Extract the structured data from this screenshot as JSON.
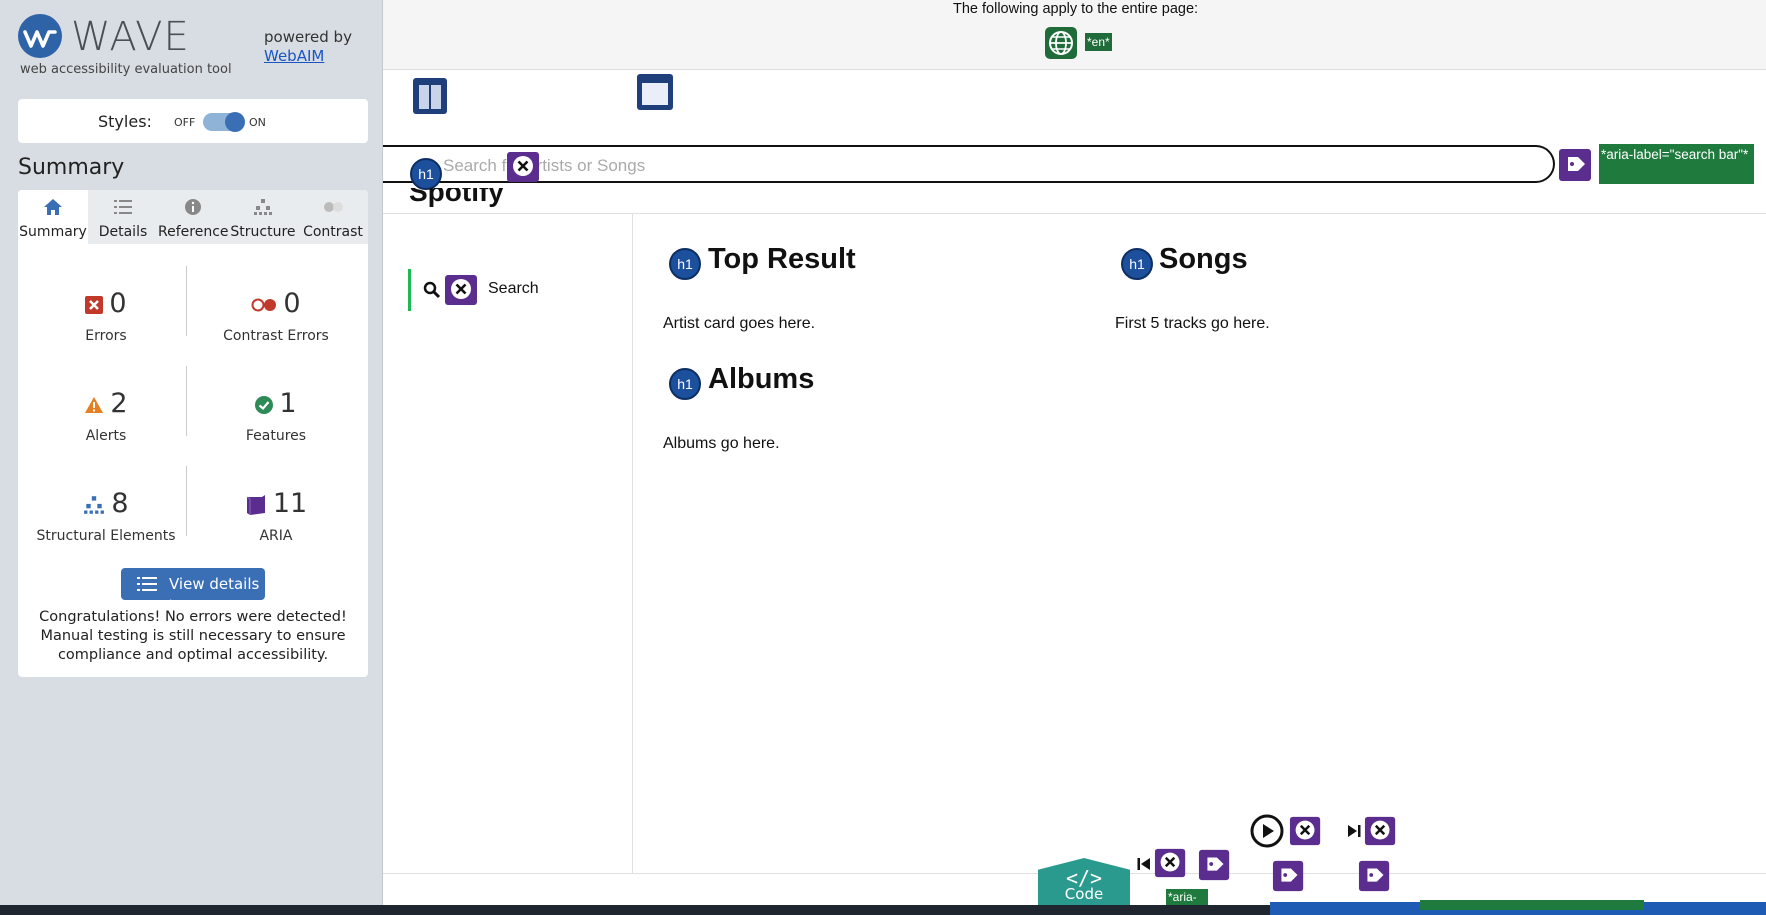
{
  "wave": {
    "wordmark": "WAVE",
    "subtitle": "web accessibility evaluation tool",
    "powered_by": "powered by",
    "webaim": "WebAIM",
    "styles_label": "Styles:",
    "styles_off": "OFF",
    "styles_on": "ON",
    "summary_heading": "Summary",
    "tabs": [
      {
        "label": "Summary",
        "icon": "home-icon",
        "active": true
      },
      {
        "label": "Details",
        "icon": "list-icon"
      },
      {
        "label": "Reference",
        "icon": "info-icon"
      },
      {
        "label": "Structure",
        "icon": "hierarchy-icon"
      },
      {
        "label": "Contrast",
        "icon": "contrast-icon"
      }
    ],
    "stats": {
      "errors": {
        "count": "0",
        "label": "Errors"
      },
      "contrast_errors": {
        "count": "0",
        "label": "Contrast Errors"
      },
      "alerts": {
        "count": "2",
        "label": "Alerts"
      },
      "features": {
        "count": "1",
        "label": "Features"
      },
      "structural": {
        "count": "8",
        "label": "Structural Elements"
      },
      "aria": {
        "count": "11",
        "label": "ARIA"
      }
    },
    "view_details": "View details ›",
    "congrats": "Congratulations! No errors were detected! Manual testing is still necessary to ensure compliance and optimal accessibility.",
    "colors": {
      "accent": "#3a6fb6",
      "error": "#c0392b",
      "alert": "#e67e22",
      "feature": "#2e8b57",
      "aria": "#5b2d8e"
    }
  },
  "page": {
    "banner_text": "The following apply to the entire page:",
    "lang_tag": "*en*",
    "search_placeholder": "Search for Artists or Songs",
    "aria_label_tag": "*aria-label=\"search bar\"*",
    "brand": "Spotify",
    "nav_search": "Search",
    "sections": [
      {
        "title": "Top Result",
        "text": "Artist card goes here."
      },
      {
        "title": "Songs",
        "text": "First 5 tracks go here."
      },
      {
        "title": "Albums",
        "text": "Albums go here."
      }
    ],
    "h1_badge": "h1",
    "code_tab": {
      "glyph": "</>",
      "label": "Code"
    },
    "aria_mini_tag": "*aria-"
  }
}
